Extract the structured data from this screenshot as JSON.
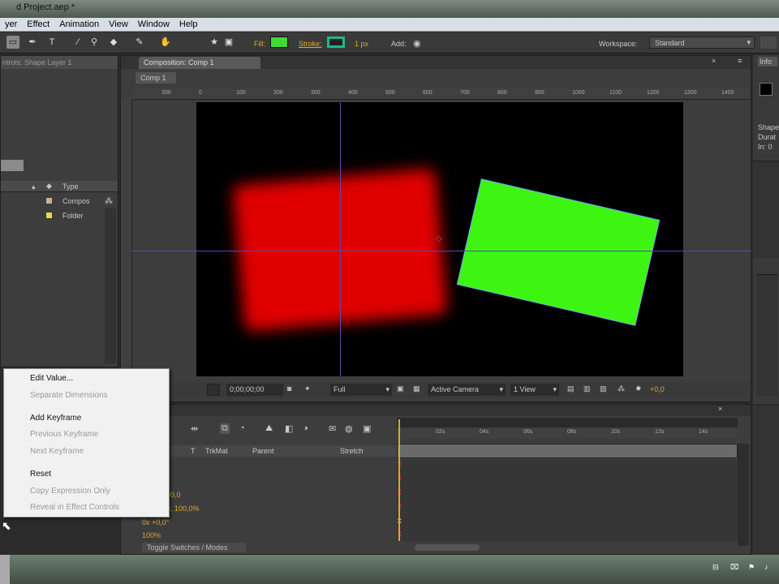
{
  "window": {
    "title": "d Project.aep *"
  },
  "menu": [
    "yer",
    "Effect",
    "Animation",
    "View",
    "Window",
    "Help"
  ],
  "toolbar": {
    "fill_label": "Fill:",
    "fill_color": "#3cde2e",
    "stroke_label": "Stroke:",
    "stroke_color": "#1fb88a",
    "stroke_width": "1 px",
    "add_label": "Add:",
    "workspace_label": "Workspace:",
    "workspace_value": "Standard"
  },
  "project_panel": {
    "header": "ntrols: Shape Layer 1",
    "col_type": "Type",
    "items": [
      {
        "name": "Compos",
        "color": "#c8b68a"
      },
      {
        "name": "Folder",
        "color": "#e8d84a"
      }
    ]
  },
  "comp_panel": {
    "tab": "Composition: Comp 1",
    "sub_tab": "Comp 1",
    "ruler_ticks": [
      "200",
      "0",
      "100",
      "200",
      "300",
      "400",
      "500",
      "600",
      "700",
      "800",
      "900",
      "1000",
      "1100",
      "1200",
      "1300",
      "1400"
    ],
    "controls": {
      "timecode": "0;00;00;00",
      "resolution": "Full",
      "camera": "Active Camera",
      "views": "1 View",
      "offset": "+0,0"
    }
  },
  "info_panel": {
    "tab": "Info",
    "lines": [
      "Shape",
      "Durat",
      "In: 0"
    ]
  },
  "timeline": {
    "headers": [
      "T",
      "TrkMat",
      "Parent",
      "Stretch"
    ],
    "ruler": [
      "02s",
      "04s",
      "06s",
      "08s",
      "10s",
      "12s",
      "14s"
    ],
    "values": [
      "00,0",
      "0, 100,0%",
      "0x +0,0°",
      "100%"
    ],
    "footer": "Toggle Switches / Modes"
  },
  "context_menu": [
    {
      "label": "Edit Value...",
      "enabled": true
    },
    {
      "label": "Separate Dimensions",
      "enabled": false
    },
    {
      "label": "Add Keyframe",
      "enabled": true
    },
    {
      "label": "Previous Keyframe",
      "enabled": false
    },
    {
      "label": "Next Keyframe",
      "enabled": false
    },
    {
      "label": "Reset",
      "enabled": true
    },
    {
      "label": "Copy Expression Only",
      "enabled": false
    },
    {
      "label": "Reveal in Effect Controls",
      "enabled": false
    }
  ],
  "colors": {
    "red_shape": "#e00000",
    "green_shape": "#3ef512",
    "accent": "#e0a62c"
  }
}
